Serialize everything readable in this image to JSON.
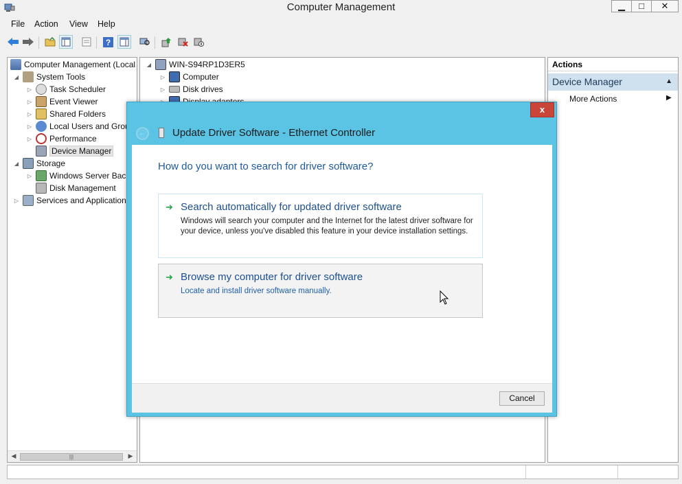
{
  "window": {
    "title": "Computer Management"
  },
  "menu": [
    "File",
    "Action",
    "View",
    "Help"
  ],
  "left_tree": [
    {
      "label": "Computer Management (Local",
      "icon": "computer-management-icon"
    },
    {
      "label": "System Tools",
      "icon": "tools-icon"
    },
    {
      "label": "Task Scheduler",
      "icon": "clock-icon"
    },
    {
      "label": "Event Viewer",
      "icon": "event-viewer-icon"
    },
    {
      "label": "Shared Folders",
      "icon": "shared-folders-icon"
    },
    {
      "label": "Local Users and Grou",
      "icon": "users-icon"
    },
    {
      "label": "Performance",
      "icon": "performance-icon"
    },
    {
      "label": "Device Manager",
      "icon": "device-manager-icon"
    },
    {
      "label": "Storage",
      "icon": "storage-icon"
    },
    {
      "label": "Windows Server Back",
      "icon": "backup-icon"
    },
    {
      "label": "Disk Management",
      "icon": "disk-management-icon"
    },
    {
      "label": "Services and Application",
      "icon": "services-icon"
    }
  ],
  "device_tree": {
    "root": "WIN-S94RP1D3ER5",
    "items": [
      "Computer",
      "Disk drives",
      "Display adapters"
    ]
  },
  "actions": {
    "header": "Actions",
    "section": "Device Manager",
    "more": "More Actions"
  },
  "dialog": {
    "title": "Update Driver Software - Ethernet Controller",
    "question": "How do you want to search for driver software?",
    "option_auto": {
      "title": "Search automatically for updated driver software",
      "description": "Windows will search your computer and the Internet for the latest driver software for your device, unless you've disabled this feature in your device installation settings."
    },
    "option_browse": {
      "title": "Browse my computer for driver software",
      "description": "Locate and install driver software manually."
    },
    "cancel": "Cancel",
    "close": "x"
  },
  "colors": {
    "dialog_frame": "#5bc4e5",
    "link_blue": "#1d4f8f",
    "arrow_green": "#22a84a",
    "close_red": "#c9453a",
    "actions_section": "#cfe0ee"
  }
}
